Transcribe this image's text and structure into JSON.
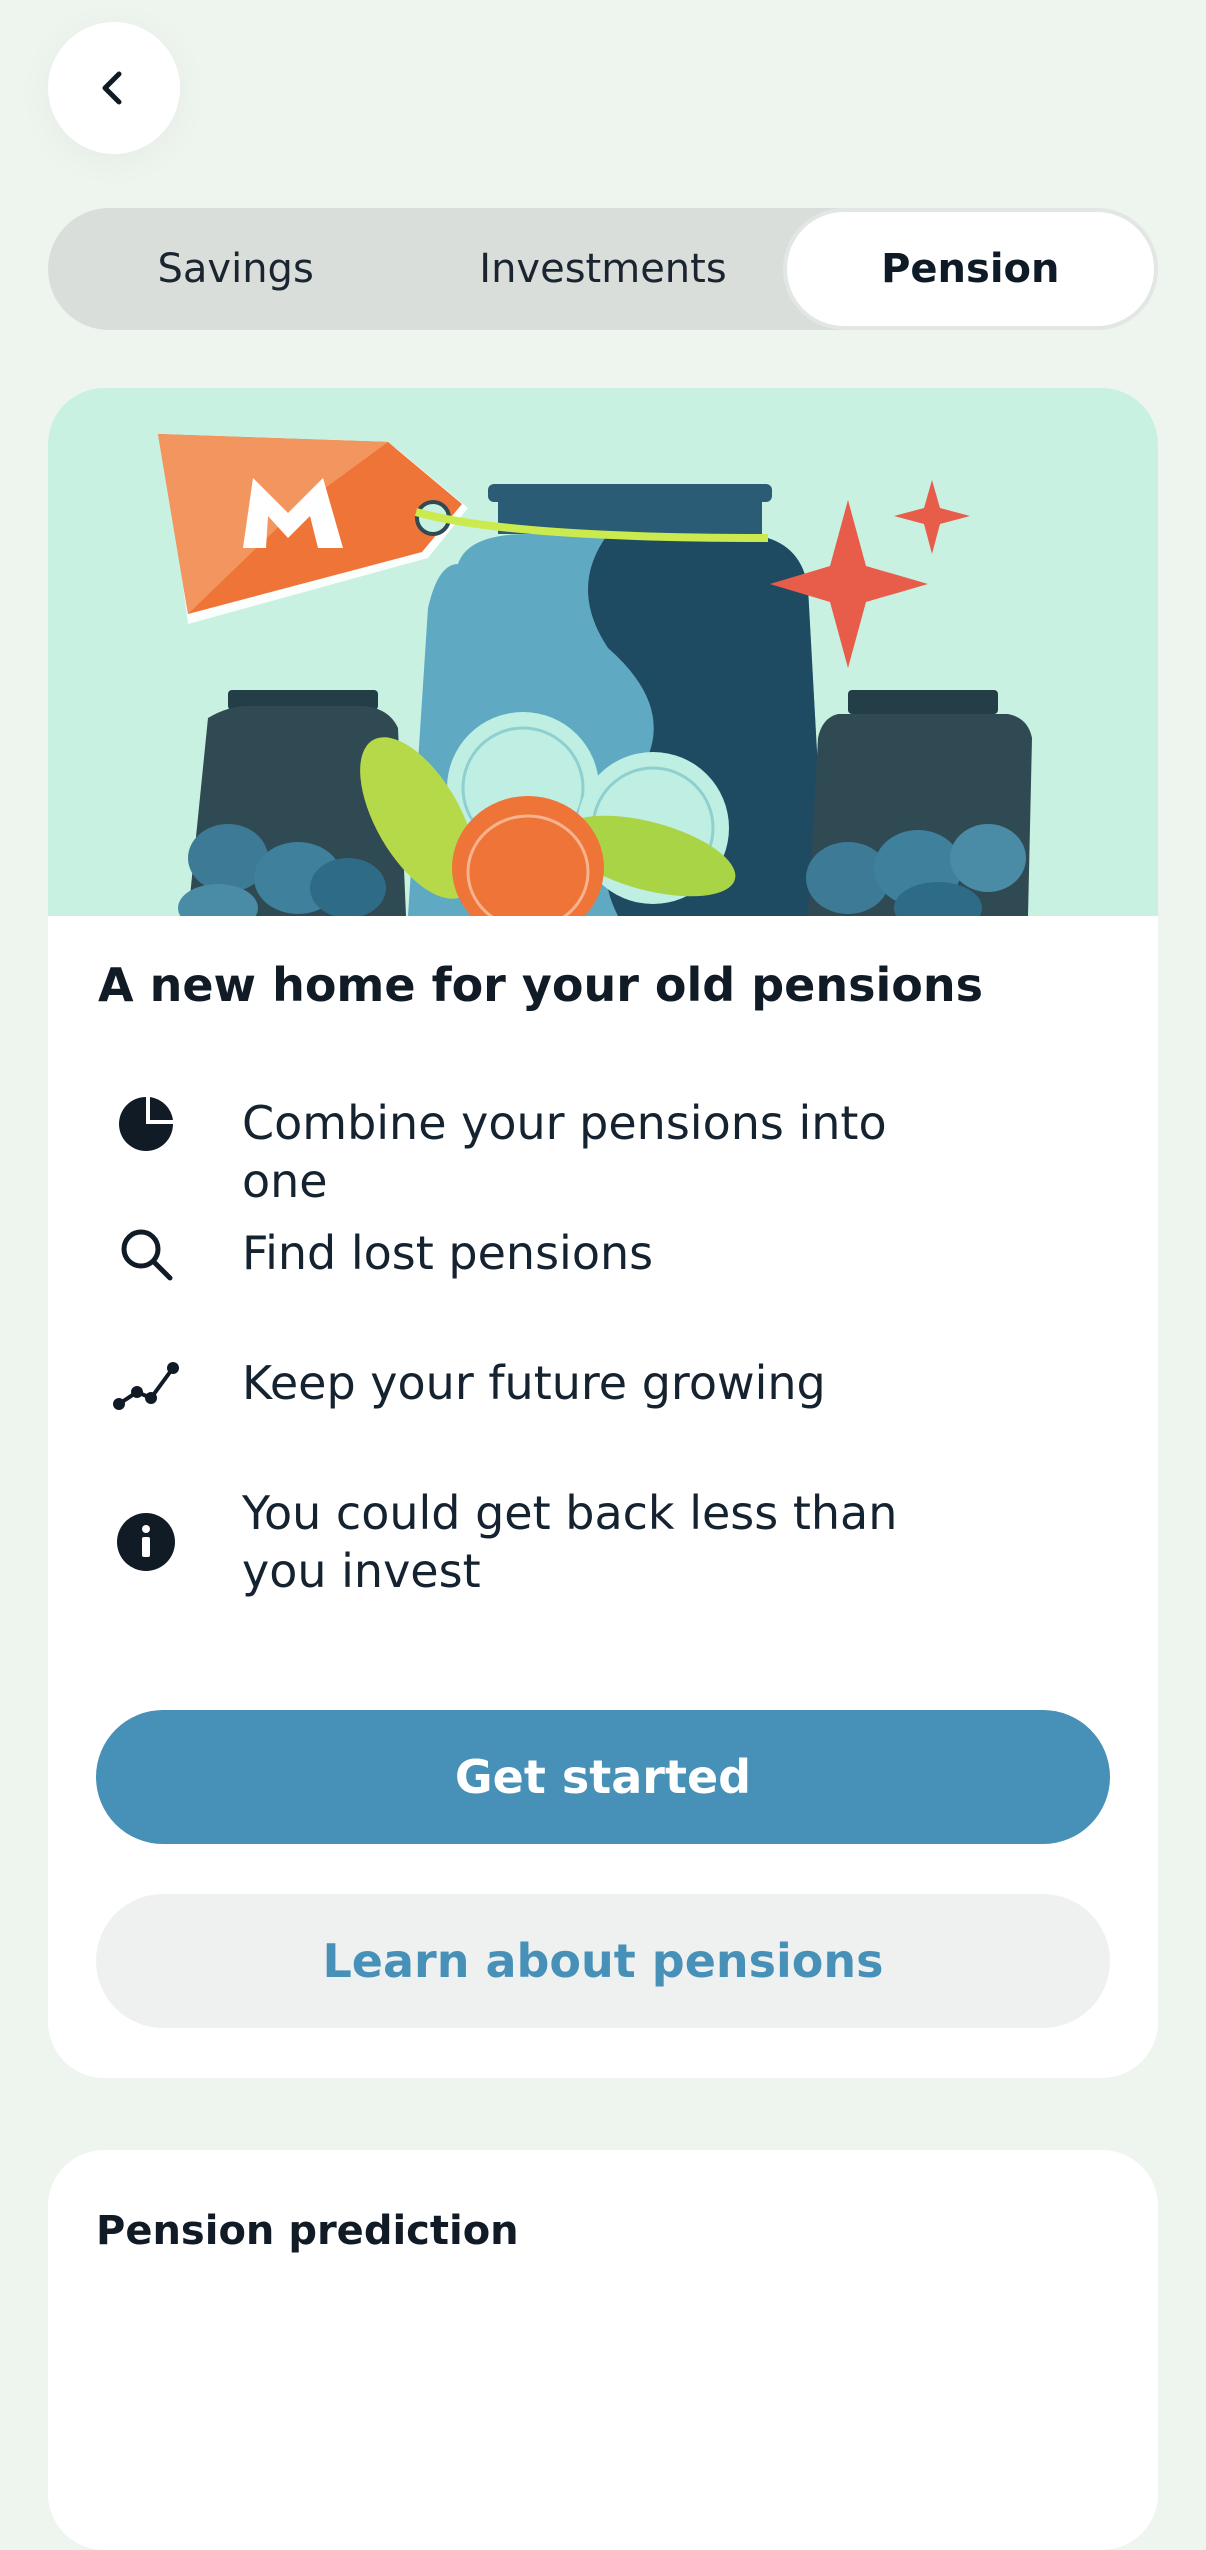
{
  "header": {
    "back_icon": "chevron-left-icon"
  },
  "tabs": [
    {
      "label": "Savings",
      "active": false
    },
    {
      "label": "Investments",
      "active": false
    },
    {
      "label": "Pension",
      "active": true
    }
  ],
  "promo_card": {
    "title": "A new home for your old pensions",
    "features": [
      {
        "icon": "pie-chart-icon",
        "text": "Combine your pensions into one"
      },
      {
        "icon": "search-icon",
        "text": "Find lost pensions"
      },
      {
        "icon": "trend-line-icon",
        "text": "Keep your future growing"
      },
      {
        "icon": "info-icon",
        "text": "You could get back less than you invest"
      }
    ],
    "primary_button": "Get started",
    "secondary_button": "Learn about pensions"
  },
  "prediction_card": {
    "title": "Pension prediction"
  },
  "colors": {
    "background": "#EEF5EF",
    "accent": "#4790B7",
    "hero_bg": "#C8F1E1",
    "tag_orange": "#EE7437",
    "sparkle_red": "#E85C4A"
  }
}
